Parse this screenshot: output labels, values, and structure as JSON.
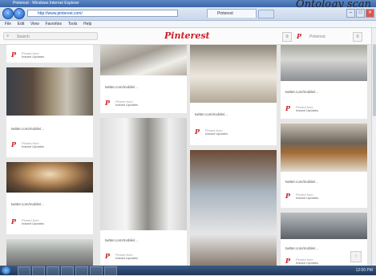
{
  "window": {
    "title": "Pinterest - Windows Internet Explorer",
    "watermark": "Ontology scan"
  },
  "toolbar": {
    "back_label": "‹",
    "forward_label": "›",
    "address_value": "http://www.pinterest.com/",
    "tab_label": "Pinterest",
    "caption_min": "–",
    "caption_max": "□",
    "caption_close": "✕"
  },
  "menu": {
    "items": [
      "File",
      "Edit",
      "View",
      "Favorites",
      "Tools",
      "Help"
    ]
  },
  "header": {
    "search_placeholder": "Search",
    "logo": "Pinterest",
    "menu_btn": "≡",
    "add_btn": "+",
    "user_text": "Pinterest",
    "more_btn": "≡"
  },
  "pin_source": {
    "line1": "Pinned from",
    "line2": "Instant Updates"
  },
  "pin_mark": "P",
  "pins": [
    {
      "desc": ""
    },
    {
      "desc": "twitter.com/mobile/..."
    },
    {
      "desc": "twitter.com/mobile/..."
    },
    {
      "desc": "twitter.com/mobile/..."
    },
    {
      "desc": "twitter.com/mobile/..."
    },
    {
      "desc": "twitter.com/mobile/..."
    },
    {
      "desc": "twitter.com/mobile/..."
    },
    {
      "desc": "twitter.com/mobile/..."
    },
    {
      "desc": "twitter.com/mobile/..."
    },
    {
      "desc": "twitter.com/mobile/..."
    },
    {
      "desc": "twitter.com/mobile/..."
    },
    {
      "desc": "twitter.com/mobile/..."
    }
  ],
  "scroll_top_label": "↑",
  "taskbar": {
    "clock": "12:00 PM"
  }
}
